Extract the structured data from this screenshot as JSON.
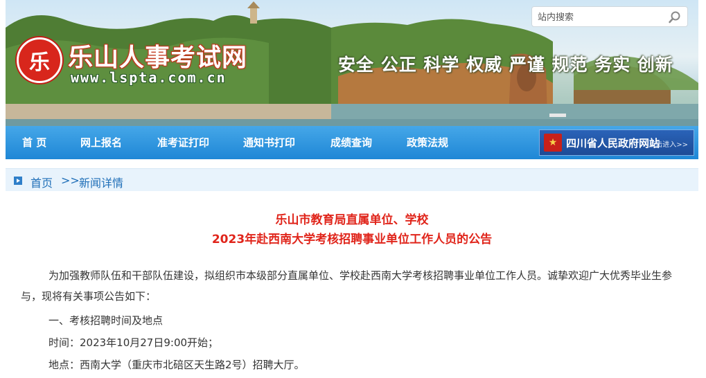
{
  "header": {
    "logo_char": "乐",
    "site_name": "乐山人事考试网",
    "site_url": "www.lspta.com.cn",
    "slogan": "安全 公正 科学 权威 严谨 规范 务实 创新",
    "search_placeholder": "站内搜索"
  },
  "nav": {
    "items": [
      "首 页",
      "网上报名",
      "准考证打印",
      "通知书打印",
      "成绩查询",
      "政策法规"
    ],
    "gov_link": {
      "label": "四川省人民政府网站",
      "enter": "点击进入>>"
    }
  },
  "breadcrumb": {
    "home": "首页",
    "separator": ">>",
    "current": "新闻详情"
  },
  "article": {
    "title_line1": "乐山市教育局直属单位、学校",
    "title_line2": "2023年赴西南大学考核招聘事业单位工作人员的公告",
    "paragraphs": [
      "为加强教师队伍和干部队伍建设，拟组织市本级部分直属单位、学校赴西南大学考核招聘事业单位工作人员。诚挚欢迎广大优秀毕业生参与，现将有关事项公告如下：",
      "一、考核招聘时间及地点",
      "时间：2023年10月27日9:00开始；",
      "地点：西南大学（重庆市北碚区天生路2号）招聘大厅。"
    ]
  },
  "colors": {
    "nav_bar": "#2a90dc",
    "title_red": "#e0251b",
    "breadcrumb_bg": "#e8f3fc",
    "logo_red": "#d8261c"
  }
}
